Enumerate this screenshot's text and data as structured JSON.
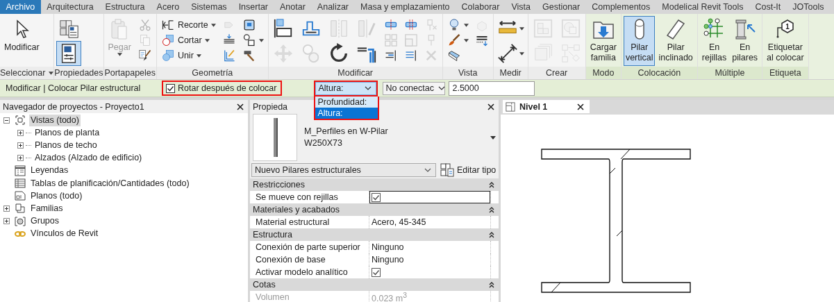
{
  "menu_tabs": [
    {
      "label": "Archivo",
      "selected": true
    },
    {
      "label": "Arquitectura",
      "selected": false
    },
    {
      "label": "Estructura",
      "selected": false
    },
    {
      "label": "Acero",
      "selected": false
    },
    {
      "label": "Sistemas",
      "selected": false
    },
    {
      "label": "Insertar",
      "selected": false
    },
    {
      "label": "Anotar",
      "selected": false
    },
    {
      "label": "Analizar",
      "selected": false
    },
    {
      "label": "Masa y emplazamiento",
      "selected": false
    },
    {
      "label": "Colaborar",
      "selected": false
    },
    {
      "label": "Vista",
      "selected": false
    },
    {
      "label": "Gestionar",
      "selected": false
    },
    {
      "label": "Complementos",
      "selected": false
    },
    {
      "label": "Modelical Revit Tools",
      "selected": false
    },
    {
      "label": "Cost-It",
      "selected": false
    },
    {
      "label": "JOTools",
      "selected": false
    }
  ],
  "ribbon": {
    "panels": [
      {
        "title": "Seleccionar",
        "title_dropdown": true,
        "contextual": false,
        "tools": [
          {
            "kind": "large",
            "label": "Modificar",
            "disabled": false,
            "selected": false
          }
        ]
      },
      {
        "title": "Propiedades",
        "contextual": false,
        "tools": [
          {
            "kind": "medium",
            "disabled": false,
            "selected": false
          },
          {
            "kind": "medium",
            "disabled": false,
            "selected": true
          }
        ]
      },
      {
        "title": "Portapapeles",
        "contextual": false,
        "tools": [
          {
            "kind": "large",
            "label": "Pegar",
            "disabled": true,
            "selected": false,
            "dropdown": true
          },
          {
            "kind": "small",
            "disabled": true,
            "selected": false
          },
          {
            "kind": "small",
            "disabled": true,
            "selected": false
          },
          {
            "kind": "small",
            "disabled": false,
            "selected": false
          }
        ]
      },
      {
        "title": "Geometría",
        "contextual": false,
        "tools": [
          {
            "kind": "small",
            "label": "Recorte",
            "disabled": false,
            "selected": false,
            "dropdown": true
          },
          {
            "kind": "small",
            "label": "Cortar",
            "disabled": false,
            "selected": false,
            "dropdown": true
          },
          {
            "kind": "small",
            "label": "Unir",
            "disabled": false,
            "selected": false,
            "dropdown": true
          },
          {
            "kind": "small",
            "disabled": true,
            "selected": false
          },
          {
            "kind": "small",
            "disabled": false,
            "selected": false
          },
          {
            "kind": "small",
            "disabled": false,
            "selected": false
          },
          {
            "kind": "small",
            "disabled": false,
            "selected": false
          },
          {
            "kind": "small",
            "disabled": false,
            "selected": false,
            "dropdown": true
          },
          {
            "kind": "small",
            "disabled": false,
            "selected": false
          }
        ]
      },
      {
        "title": "Modificar",
        "contextual": false,
        "tools": [
          {
            "kind": "medium",
            "disabled": false,
            "selected": false
          },
          {
            "kind": "medium",
            "disabled": true,
            "selected": false
          },
          {
            "kind": "medium",
            "disabled": false,
            "selected": false
          },
          {
            "kind": "medium",
            "disabled": true,
            "selected": false
          },
          {
            "kind": "medium",
            "disabled": true,
            "selected": false
          },
          {
            "kind": "medium",
            "disabled": false,
            "selected": false
          },
          {
            "kind": "medium",
            "disabled": true,
            "selected": false
          },
          {
            "kind": "medium",
            "disabled": false,
            "selected": false
          },
          {
            "kind": "small",
            "disabled": false,
            "selected": false
          },
          {
            "kind": "small",
            "disabled": true,
            "selected": false
          },
          {
            "kind": "small",
            "disabled": false,
            "selected": false
          },
          {
            "kind": "small",
            "disabled": false,
            "selected": false
          },
          {
            "kind": "small",
            "disabled": true,
            "selected": false
          },
          {
            "kind": "small",
            "disabled": false,
            "selected": false
          },
          {
            "kind": "small",
            "disabled": true,
            "selected": false
          },
          {
            "kind": "small",
            "disabled": true,
            "selected": false
          },
          {
            "kind": "small",
            "disabled": true,
            "selected": false
          }
        ]
      },
      {
        "title": "Vista",
        "contextual": false,
        "tools": [
          {
            "kind": "small",
            "disabled": false,
            "selected": false,
            "dropdown": true
          },
          {
            "kind": "small",
            "disabled": false,
            "selected": false,
            "dropdown": true
          },
          {
            "kind": "small",
            "disabled": false,
            "selected": false
          },
          {
            "kind": "small",
            "disabled": true,
            "selected": false
          },
          {
            "kind": "small",
            "disabled": false,
            "selected": false
          }
        ]
      },
      {
        "title": "Medir",
        "contextual": false,
        "tools": [
          {
            "kind": "medium",
            "disabled": false,
            "selected": false,
            "dropdown": true
          },
          {
            "kind": "medium",
            "disabled": false,
            "selected": false,
            "dropdown": true
          }
        ]
      },
      {
        "title": "Crear",
        "contextual": false,
        "tools": [
          {
            "kind": "medium",
            "disabled": true,
            "selected": false
          },
          {
            "kind": "medium",
            "disabled": true,
            "selected": false
          },
          {
            "kind": "medium",
            "disabled": true,
            "selected": false
          },
          {
            "kind": "medium",
            "disabled": true,
            "selected": false
          }
        ]
      },
      {
        "title": "Modo",
        "contextual": true,
        "tools": [
          {
            "kind": "large",
            "label": "Cargar\nfamilia",
            "disabled": false,
            "selected": false
          }
        ]
      },
      {
        "title": "Colocación",
        "contextual": true,
        "tools": [
          {
            "kind": "large",
            "label": "Pilar\nvertical",
            "disabled": false,
            "selected": true
          },
          {
            "kind": "large",
            "label": "Pilar\ninclinado",
            "disabled": false,
            "selected": false
          }
        ]
      },
      {
        "title": "Múltiple",
        "contextual": true,
        "tools": [
          {
            "kind": "large",
            "label": "En\nrejillas",
            "disabled": false,
            "selected": false
          },
          {
            "kind": "large",
            "label": "En\npilares",
            "disabled": false,
            "selected": false
          }
        ]
      },
      {
        "title": "Etiqueta",
        "contextual": true,
        "tools": [
          {
            "kind": "large",
            "label": "Etiquetar\nal colocar",
            "badge": "1",
            "disabled": false,
            "selected": false
          }
        ]
      }
    ]
  },
  "options_bar": {
    "context": "Modificar | Colocar Pilar estructural",
    "checkbox": {
      "label": "Rotar después de colocar",
      "checked": true,
      "highlighted": true
    },
    "dropdowns": [
      {
        "value": "Altura:",
        "highlighted": true,
        "open": true,
        "options": [
          {
            "label": "Profundidad:",
            "selected": false
          },
          {
            "label": "Altura:",
            "selected": true
          }
        ]
      },
      {
        "value": "No conectac",
        "highlighted": false,
        "open": false
      }
    ],
    "field": {
      "value": "2.5000"
    }
  },
  "project_browser": {
    "title": "Navegador de proyectos - Proyecto1",
    "tree": [
      {
        "label": "Vistas (todo)",
        "selected": true,
        "expanded": true,
        "children": [
          {
            "label": "Planos de planta",
            "selected": false,
            "expanded": false
          },
          {
            "label": "Planos de techo",
            "selected": false,
            "expanded": false
          },
          {
            "label": "Alzados (Alzado de edificio)",
            "selected": false,
            "expanded": false
          }
        ]
      },
      {
        "label": "Leyendas",
        "selected": false
      },
      {
        "label": "Tablas de planificación/Cantidades (todo)",
        "selected": false
      },
      {
        "label": "Planos (todo)",
        "selected": false
      },
      {
        "label": "Familias",
        "selected": false,
        "expanded": false
      },
      {
        "label": "Grupos",
        "selected": false,
        "expanded": false
      },
      {
        "label": "Vínculos de Revit",
        "selected": false
      }
    ]
  },
  "properties": {
    "title": "Propieda",
    "type_family": "M_Perfiles en W-Pilar",
    "type_name": "W250X73",
    "type_selector": "Nuevo Pilares estructurales",
    "edit_type": "Editar tipo",
    "groups": [
      {
        "name": "Restricciones",
        "rows": [
          {
            "label": "Se mueve con rejillas",
            "kind": "check",
            "checked": true,
            "focused": true,
            "disabled": false
          }
        ]
      },
      {
        "name": "Materiales y acabados",
        "rows": [
          {
            "label": "Material estructural",
            "kind": "text",
            "value": "Acero, 45-345",
            "focused": false,
            "disabled": false
          }
        ]
      },
      {
        "name": "Estructura",
        "rows": [
          {
            "label": "Conexión de parte superior",
            "kind": "text",
            "value": "Ninguno",
            "focused": false,
            "disabled": false
          },
          {
            "label": "Conexión de base",
            "kind": "text",
            "value": "Ninguno",
            "focused": false,
            "disabled": false
          },
          {
            "label": "Activar modelo analítico",
            "kind": "check",
            "checked": true,
            "focused": false,
            "disabled": false
          }
        ]
      },
      {
        "name": "Cotas",
        "rows": [
          {
            "label": "Volumen",
            "kind": "text",
            "value": "0.023 m$^{3}$",
            "focused": false,
            "disabled": true
          }
        ]
      }
    ]
  },
  "view_tabs": [
    {
      "label": "Nivel 1",
      "selected": true
    }
  ]
}
